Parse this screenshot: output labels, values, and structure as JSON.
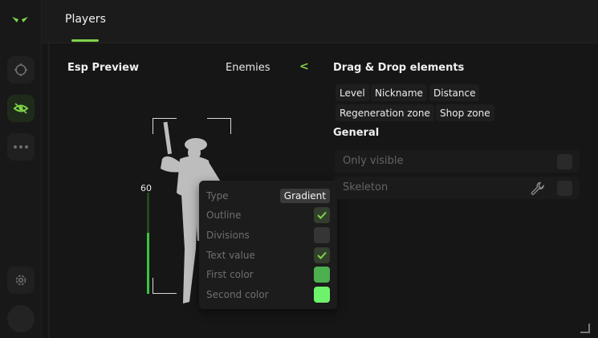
{
  "header": {
    "active_tab": "Players"
  },
  "preview": {
    "title": "Esp Preview",
    "target": "Enemies",
    "target_chevron": "<",
    "health_value": "60",
    "health_fraction": 0.6
  },
  "popup": {
    "rows": [
      {
        "label": "Type",
        "value": "Gradient"
      },
      {
        "label": "Outline",
        "checked": true
      },
      {
        "label": "Divisions",
        "checked": false
      },
      {
        "label": "Text value",
        "checked": true
      },
      {
        "label": "First color",
        "color": "#4caf50"
      },
      {
        "label": "Second color",
        "color": "#6ff26b"
      }
    ]
  },
  "dnd": {
    "title": "Drag & Drop elements",
    "chips": [
      "Level",
      "Nickname",
      "Distance",
      "Regeneration zone",
      "Shop zone"
    ]
  },
  "general": {
    "title": "General",
    "rows": [
      {
        "label": "Only visible"
      },
      {
        "label": "Skeleton"
      }
    ]
  },
  "colors": {
    "accent": "#7fd34a",
    "health": "#39c43c"
  }
}
